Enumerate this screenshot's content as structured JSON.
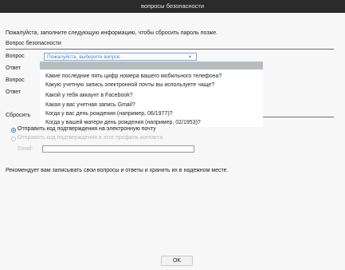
{
  "window": {
    "title": "вопросы безопасности"
  },
  "intro": {
    "text": "Пожалуйста, заполните следующую информацию, чтобы сбросить пароль позже.",
    "section_label": "Вопрос безопасности"
  },
  "form": {
    "question1_label": "Вопрос",
    "question1_value": "Пожалуйста, выберите вопрос",
    "answer1_label": "Ответ",
    "question2_label": "Вопрос",
    "answer2_label": "Ответ",
    "reset_label": "Сбросить"
  },
  "dropdown": {
    "options": [
      "",
      "Какие последние пять цифр номера вашего мобильного телефона?",
      "Какую учетную запись электронной почты вы используете чаще?",
      "Какой у тебя аккаунт в Facebook?",
      "Какая у вас учетная запись Gmail?",
      "Когда у вас день рождения (например, 06/1977)?",
      "Когда у вашей матери день рождения (например, 02/1953)?"
    ]
  },
  "reset_options": {
    "option1_label": "Отправить код подтверждения на электронную почту",
    "option2_label": "Отправить код подтверждения в этот профиль контакта",
    "email_label": "Email:"
  },
  "footer": {
    "note": "Рекомендует вам записывать свои вопросы и ответы и хранить их в надежном месте.",
    "ok_label": "OK"
  },
  "colors": {
    "titlebar": "#2b2b2b",
    "accent": "#3f86d0",
    "highlight": "#b7bcc1"
  }
}
